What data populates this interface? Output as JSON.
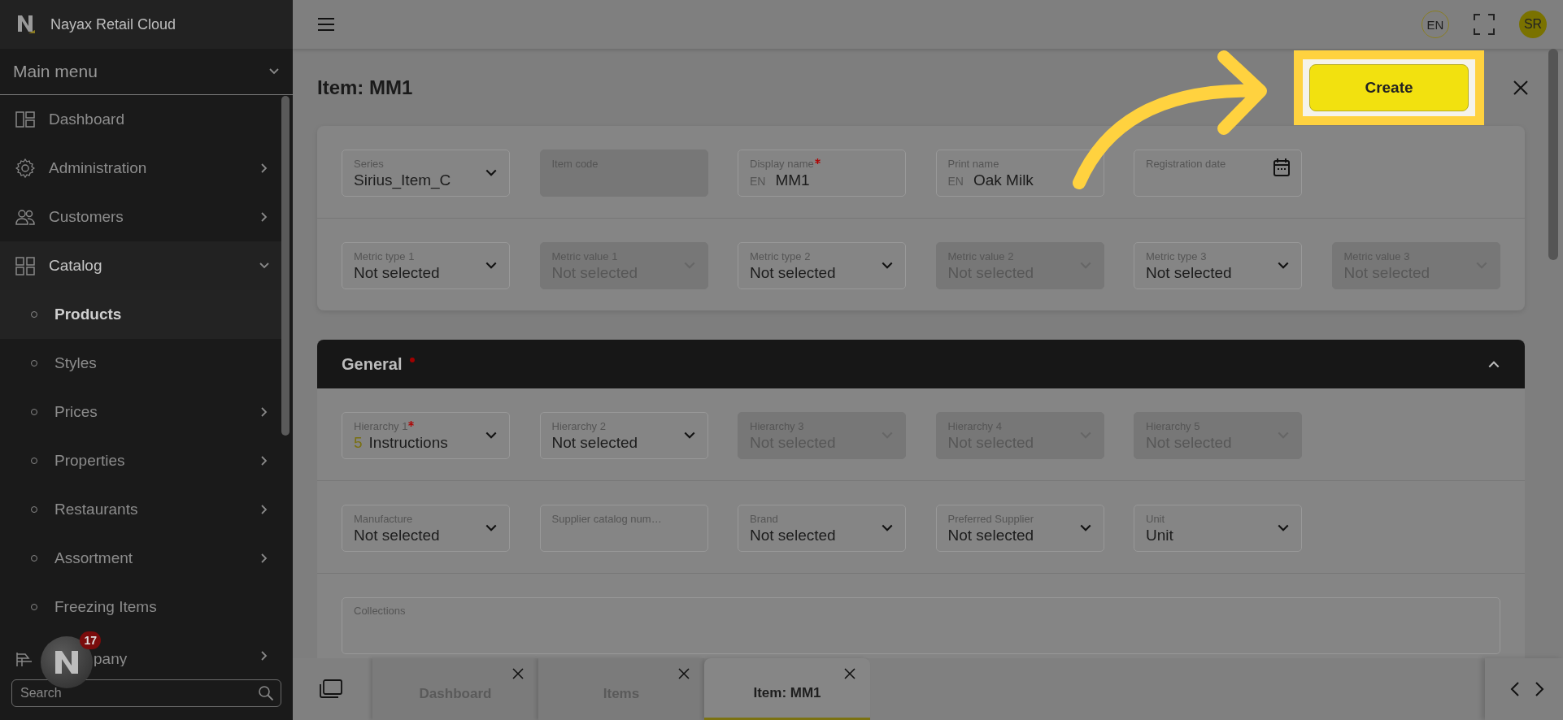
{
  "app": {
    "name": "Nayax Retail Cloud"
  },
  "sidebar": {
    "menu_title": "Main menu",
    "items": [
      {
        "label": "Dashboard",
        "has_children": false,
        "expanded": false
      },
      {
        "label": "Administration",
        "has_children": true,
        "expanded": false
      },
      {
        "label": "Customers",
        "has_children": true,
        "expanded": false
      },
      {
        "label": "Catalog",
        "has_children": true,
        "expanded": true,
        "children": [
          {
            "label": "Products",
            "has_children": false,
            "selected": true
          },
          {
            "label": "Styles",
            "has_children": false,
            "selected": false
          },
          {
            "label": "Prices",
            "has_children": true,
            "selected": false
          },
          {
            "label": "Properties",
            "has_children": true,
            "selected": false
          },
          {
            "label": "Restaurants",
            "has_children": true,
            "selected": false
          },
          {
            "label": "Assortment",
            "has_children": true,
            "selected": false
          },
          {
            "label": "Freezing Items",
            "has_children": false,
            "selected": false
          }
        ]
      },
      {
        "label": "pany",
        "has_children": true,
        "expanded": false
      }
    ],
    "search": {
      "placeholder": "Search"
    }
  },
  "notification_bubble": {
    "count": "17"
  },
  "header": {
    "language": "EN",
    "user_initials": "SR"
  },
  "page": {
    "title": "Item: MM1",
    "create_label": "Create"
  },
  "top_card": {
    "rows": [
      [
        {
          "label": "Series",
          "kind": "select",
          "value": "Sirius_Item_C",
          "disabled": false,
          "required": false
        },
        {
          "label": "Item code",
          "kind": "text",
          "disabled": true,
          "required": false
        },
        {
          "label": "Display name",
          "kind": "lang",
          "prefix": "EN",
          "value": "MM1",
          "disabled": false,
          "required": true
        },
        {
          "label": "Print name",
          "kind": "lang",
          "prefix": "EN",
          "value": "Oak Milk",
          "disabled": false,
          "required": false
        },
        {
          "label": "Registration date",
          "kind": "date",
          "disabled": false,
          "required": false
        }
      ],
      [
        {
          "label": "Metric type 1",
          "kind": "select",
          "value": "Not selected",
          "disabled": false,
          "required": false
        },
        {
          "label": "Metric value 1",
          "kind": "select",
          "value": "Not selected",
          "disabled": true,
          "required": false
        },
        {
          "label": "Metric type 2",
          "kind": "select",
          "value": "Not selected",
          "disabled": false,
          "required": false
        },
        {
          "label": "Metric value 2",
          "kind": "select",
          "value": "Not selected",
          "disabled": true,
          "required": false
        },
        {
          "label": "Metric type 3",
          "kind": "select",
          "value": "Not selected",
          "disabled": false,
          "required": false
        },
        {
          "label": "Metric value 3",
          "kind": "select",
          "value": "Not selected",
          "disabled": true,
          "required": false
        }
      ]
    ]
  },
  "sections": [
    {
      "title": "General",
      "required": true,
      "expanded": true,
      "rows": [
        [
          {
            "label": "Hierarchy 1",
            "kind": "select",
            "code": "5",
            "value": "Instructions",
            "disabled": false,
            "required": true
          },
          {
            "label": "Hierarchy 2",
            "kind": "select",
            "value": "Not selected",
            "disabled": false,
            "required": false
          },
          {
            "label": "Hierarchy 3",
            "kind": "select",
            "value": "Not selected",
            "disabled": true,
            "required": false
          },
          {
            "label": "Hierarchy 4",
            "kind": "select",
            "value": "Not selected",
            "disabled": true,
            "required": false
          },
          {
            "label": "Hierarchy 5",
            "kind": "select",
            "value": "Not selected",
            "disabled": true,
            "required": false
          }
        ],
        [
          {
            "label": "Manufacture",
            "kind": "select",
            "value": "Not selected",
            "disabled": false,
            "required": false
          },
          {
            "label": "Supplier catalog num…",
            "kind": "text",
            "disabled": false,
            "required": false
          },
          {
            "label": "Brand",
            "kind": "select",
            "value": "Not selected",
            "disabled": false,
            "required": false
          },
          {
            "label": "Preferred Supplier",
            "kind": "select",
            "value": "Not selected",
            "disabled": false,
            "required": false
          },
          {
            "label": "Unit",
            "kind": "select",
            "value": "Unit",
            "disabled": false,
            "required": false
          }
        ],
        [
          {
            "label": "Collections",
            "kind": "multi",
            "disabled": false,
            "required": false
          }
        ]
      ]
    }
  ],
  "tabs": [
    {
      "label": "Dashboard",
      "selected": false
    },
    {
      "label": "Items",
      "selected": false
    },
    {
      "label": "Item: MM1",
      "selected": true
    }
  ]
}
